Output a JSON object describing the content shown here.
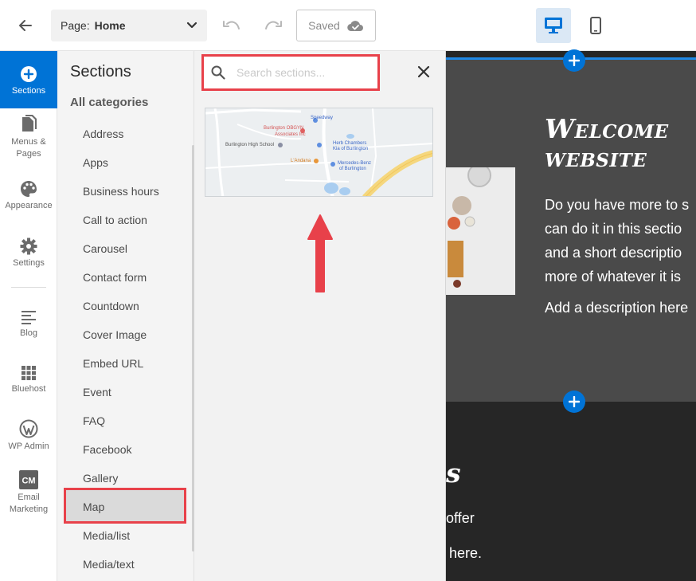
{
  "topbar": {
    "page_label": "Page:",
    "page_value": "Home",
    "saved_label": "Saved"
  },
  "rail": {
    "items": [
      {
        "label": "Sections",
        "icon": "plus-circle-icon",
        "active": true
      },
      {
        "label": "Menus & Pages",
        "icon": "pages-icon"
      },
      {
        "label": "Appearance",
        "icon": "palette-icon"
      },
      {
        "label": "Settings",
        "icon": "gear-icon"
      },
      {
        "label": "Blog",
        "icon": "blog-icon"
      },
      {
        "label": "Bluehost",
        "icon": "grid-icon"
      },
      {
        "label": "WP Admin",
        "icon": "wordpress-icon"
      },
      {
        "label": "Email Marketing",
        "icon": "cm-icon"
      }
    ]
  },
  "panel": {
    "title": "Sections",
    "all_categories": "All categories",
    "categories": [
      "Address",
      "Apps",
      "Business hours",
      "Call to action",
      "Carousel",
      "Contact form",
      "Countdown",
      "Cover Image",
      "Embed URL",
      "Event",
      "FAQ",
      "Facebook",
      "Gallery",
      "Map",
      "Media/list",
      "Media/text"
    ],
    "selected": "Map"
  },
  "search": {
    "placeholder": "Search sections...",
    "value": ""
  },
  "map_thumb": {
    "labels": [
      "Speedway",
      "Burlington OBGYN",
      "Associates Inc",
      "Burlington High School",
      "Herb Chambers",
      "Kia of Burlington",
      "L'Andana",
      "Mercedes-Benz",
      "of Burlington"
    ]
  },
  "site": {
    "hero_title_1": "Welcome",
    "hero_title_2": "website",
    "hero_body": [
      "Do you have more to s",
      "can do it in this sectio",
      "and a short descriptio",
      "more of whatever it is"
    ],
    "hero_desc": "Add a description here",
    "dark_title": "s",
    "dark_line1": "offer",
    "dark_line2": "here."
  },
  "colors": {
    "accent": "#0073d6",
    "highlight": "#e8414a",
    "hero_bg": "#4a4a4a",
    "dark_bg": "#262626"
  }
}
